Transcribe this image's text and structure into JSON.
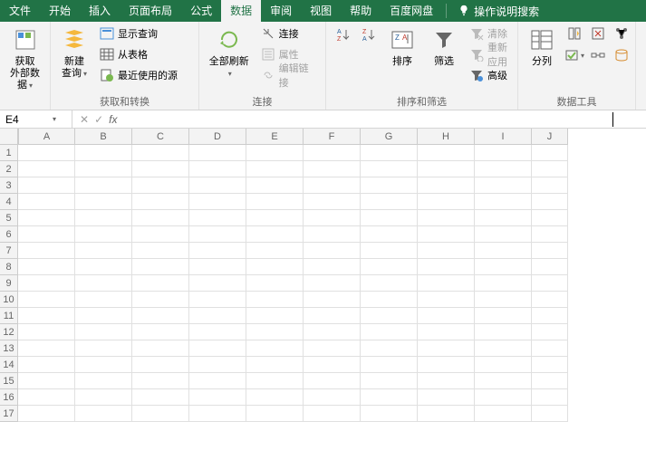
{
  "menu": {
    "file": "文件",
    "home": "开始",
    "insert": "插入",
    "layout": "页面布局",
    "formulas": "公式",
    "data": "数据",
    "review": "审阅",
    "view": "视图",
    "help": "帮助",
    "baidu": "百度网盘",
    "search": "操作说明搜索"
  },
  "ribbon": {
    "get_data": {
      "label": "获取\n外部数据"
    },
    "new_query": {
      "label": "新建\n查询"
    },
    "show_query": "显示查询",
    "from_table": "从表格",
    "recent": "最近使用的源",
    "group_transform": "获取和转换",
    "refresh_all": {
      "label": "全部刷新"
    },
    "connections": "连接",
    "properties": "属性",
    "edit_links": "编辑链接",
    "group_conn": "连接",
    "sort": {
      "label": "排序"
    },
    "filter": {
      "label": "筛选"
    },
    "clear": "清除",
    "reapply": "重新应用",
    "advanced": "高级",
    "group_sortfilter": "排序和筛选",
    "text_to_cols": {
      "label": "分列"
    },
    "group_datatools": "数据工具"
  },
  "namebox": {
    "value": "E4"
  },
  "formula": {
    "value": ""
  },
  "columns": [
    "A",
    "B",
    "C",
    "D",
    "E",
    "F",
    "G",
    "H",
    "I",
    "J"
  ],
  "rows": [
    "1",
    "2",
    "3",
    "4",
    "5",
    "6",
    "7",
    "8",
    "9",
    "10",
    "11",
    "12",
    "13",
    "14",
    "15",
    "16",
    "17"
  ]
}
